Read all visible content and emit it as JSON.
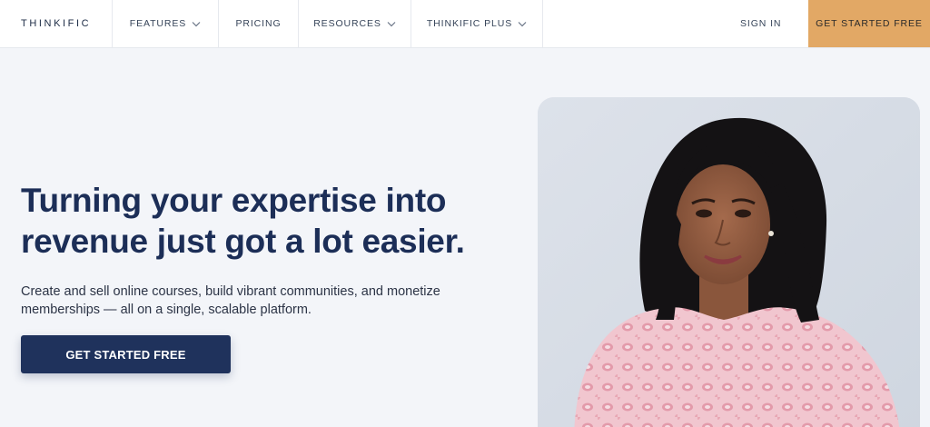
{
  "nav": {
    "logo": "THINKIFIC",
    "items": [
      {
        "label": "FEATURES",
        "has_dropdown": true
      },
      {
        "label": "PRICING",
        "has_dropdown": false
      },
      {
        "label": "RESOURCES",
        "has_dropdown": true
      },
      {
        "label": "THINKIFIC PLUS",
        "has_dropdown": true
      }
    ],
    "sign_in": "SIGN IN",
    "cta": "GET STARTED FREE"
  },
  "hero": {
    "title_line1": "Turning your expertise into",
    "title_line2": "revenue just got a lot easier.",
    "subtitle_line1": "Create and sell online courses, build vibrant communities, and monetize",
    "subtitle_line2": "memberships — all on a single, scalable platform.",
    "button": "GET STARTED FREE"
  },
  "colors": {
    "background": "#f3f5f9",
    "title": "#1c2e57",
    "primary_button": "#1f325c",
    "cta_top": "#e2a865",
    "photo_card": "#d9dfe8"
  },
  "icons": {
    "dropdown": "chevron-down-icon"
  }
}
